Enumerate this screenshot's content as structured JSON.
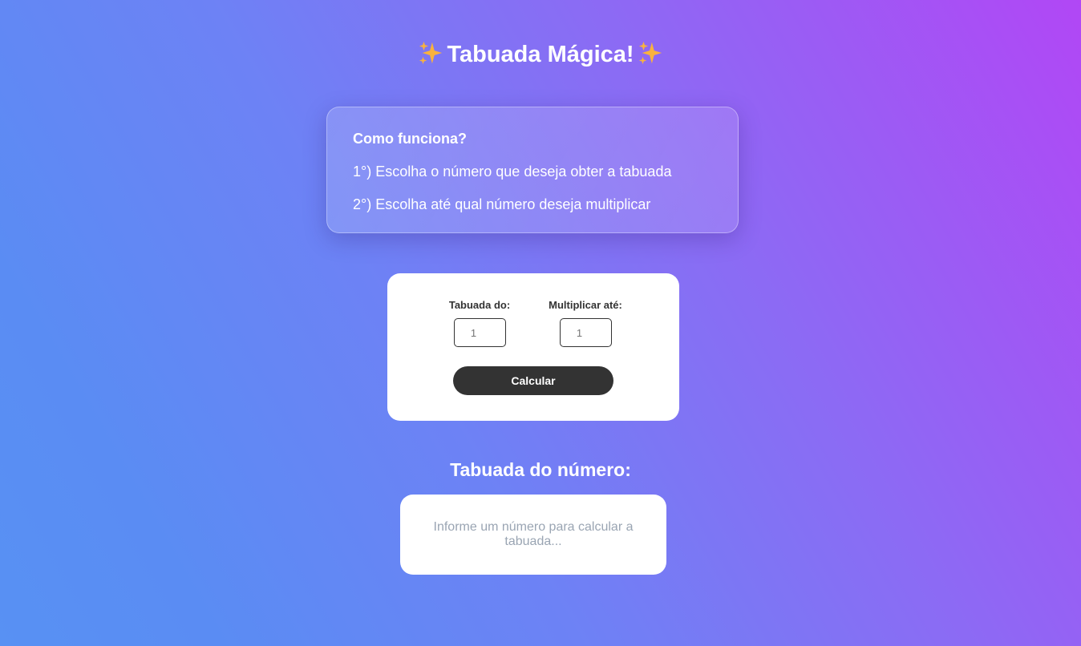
{
  "header": {
    "title": "Tabuada Mágica!",
    "sparkle_icon": "sparkles-icon"
  },
  "info": {
    "title": "Como funciona?",
    "steps": [
      "1°) Escolha o número que deseja obter a tabuada",
      "2°) Escolha até qual número deseja multiplicar"
    ]
  },
  "form": {
    "tabuada_label": "Tabuada do:",
    "tabuada_placeholder": "1",
    "multiplicar_label": "Multiplicar até:",
    "multiplicar_placeholder": "1",
    "calcular_label": "Calcular"
  },
  "result": {
    "title": "Tabuada do número:",
    "placeholder_text": "Informe um número para calcular a tabuada..."
  },
  "colors": {
    "gradient_start": "#5891f3",
    "gradient_end": "#b147f5",
    "button": "#333333"
  }
}
